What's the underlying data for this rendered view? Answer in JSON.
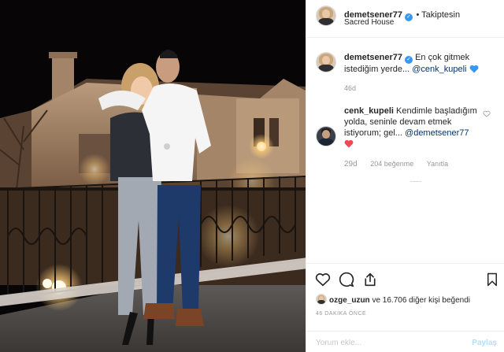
{
  "header": {
    "username": "demetsener77",
    "follow_status": "• Takiptesin",
    "location": "Sacred House"
  },
  "caption": {
    "username": "demetsener77",
    "text": "En çok gitmek istediğim yerde...",
    "mention": "@cenk_kupeli",
    "time": "46d"
  },
  "comment": {
    "username": "cenk_kupeli",
    "text": "Kendimle başladığım yolda, seninle devam etmek istiyorum; gel...",
    "mention": "@demetsener77",
    "time": "29d",
    "likes": "204 beğenme",
    "reply": "Yanıtla"
  },
  "likes": {
    "user": "ozge_uzun",
    "text": "ve 16.706 diğer kişi beğendi"
  },
  "timestamp": "46 DAKİKA ÖNCE",
  "add_comment": {
    "placeholder": "Yorum ekle...",
    "post": "Paylaş"
  },
  "colors": {
    "verified": "#3897f0",
    "heart_red": "#ed4956",
    "blue_heart": "#3897f0"
  }
}
